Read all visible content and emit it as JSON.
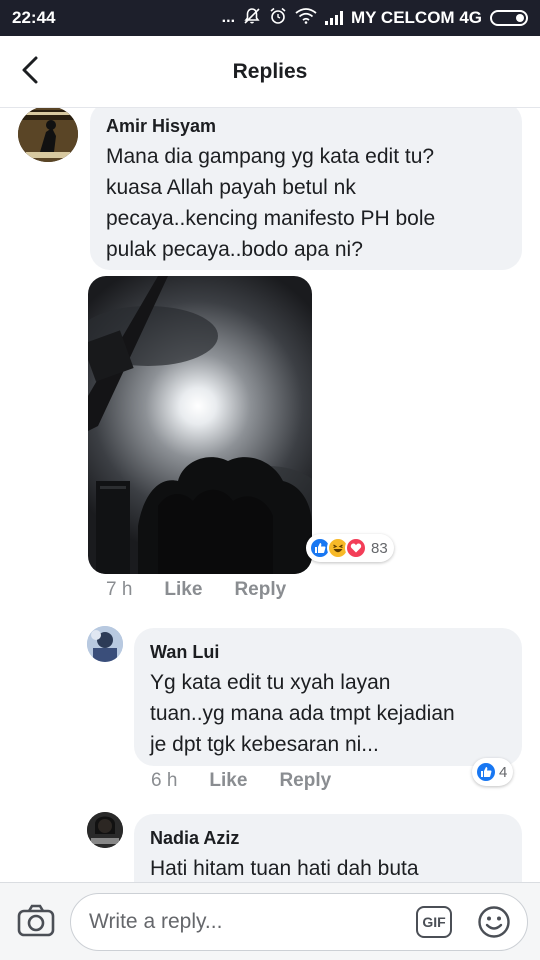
{
  "status_bar": {
    "time": "22:44",
    "dots": "...",
    "carrier": "MY CELCOM 4G"
  },
  "header": {
    "title": "Replies",
    "back_icon": "chevron-left-icon"
  },
  "comments": [
    {
      "author": "Amir Hisyam",
      "lines": [
        "Mana dia gampang yg kata edit tu?",
        "kuasa Allah payah betul nk",
        "pecaya..kencing manifesto PH bole",
        "pulak pecaya..bodo apa ni?"
      ],
      "has_photo": true,
      "reactions": {
        "icons": [
          "like",
          "haha",
          "love"
        ],
        "count": "83"
      },
      "time": "7 h",
      "like_label": "Like",
      "reply_label": "Reply"
    },
    {
      "author": "Wan Lui",
      "lines": [
        "Yg kata edit tu xyah layan",
        "tuan..yg mana ada tmpt kejadian",
        "je dpt tgk kebesaran ni..."
      ],
      "reactions": {
        "icons": [
          "like"
        ],
        "count": "4"
      },
      "time": "6 h",
      "like_label": "Like",
      "reply_label": "Reply"
    },
    {
      "author": "Nadia Aziz",
      "lines": [
        "Hati hitam tuan hati dah buta"
      ]
    }
  ],
  "composer": {
    "placeholder": "Write a reply...",
    "gif_label": "GIF",
    "camera_icon": "camera-icon",
    "emoji_icon": "smiley-icon"
  },
  "colors": {
    "status_bar": "#1d1f2b",
    "bubble": "#f0f2f5",
    "like_blue": "#1877f2",
    "love_red": "#f33e58",
    "haha_yellow": "#f7b928",
    "meta_gray": "#8a8d91"
  }
}
